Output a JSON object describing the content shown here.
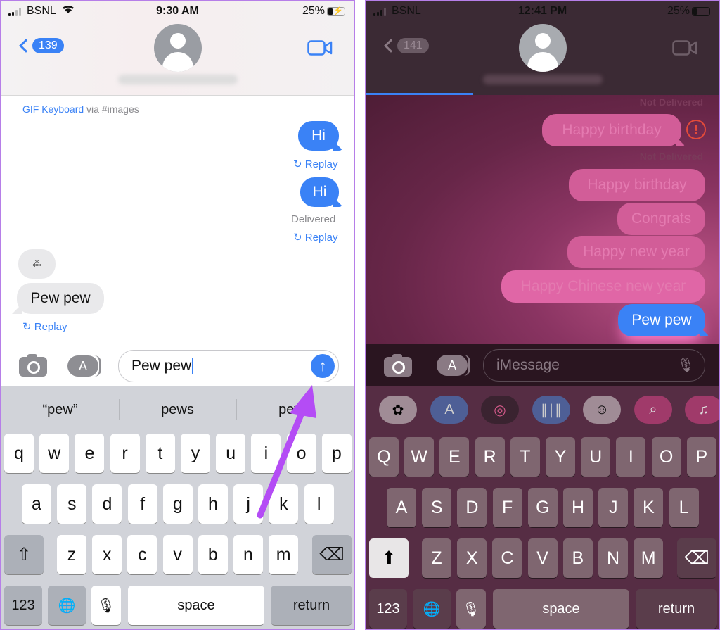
{
  "left": {
    "status": {
      "carrier": "BSNL",
      "time": "9:30 AM",
      "battery": "25%",
      "battery_level": 0.25,
      "charging": true
    },
    "header": {
      "back_count": "139",
      "contact_name": "",
      "video_icon": "video-camera-icon"
    },
    "gif_source": {
      "link": "GIF Keyboard",
      "suffix": " via #images"
    },
    "messages": [
      {
        "side": "sent",
        "text": "Hi"
      },
      {
        "side": "sent",
        "text": "Hi",
        "status": "Delivered"
      },
      {
        "side": "received",
        "text": "Pew pew",
        "sticker": true
      }
    ],
    "replay_label": "Replay",
    "input": {
      "value": "Pew pew",
      "send_icon": "arrow-up-icon"
    },
    "suggestions": [
      "“pew”",
      "pews",
      "pews"
    ],
    "keyboard": {
      "row1": [
        "q",
        "w",
        "e",
        "r",
        "t",
        "y",
        "u",
        "i",
        "o",
        "p"
      ],
      "row2": [
        "a",
        "s",
        "d",
        "f",
        "g",
        "h",
        "j",
        "k",
        "l"
      ],
      "row3": [
        "z",
        "x",
        "c",
        "v",
        "b",
        "n",
        "m"
      ],
      "shift": "⇧",
      "delete": "⌫",
      "numbers": "123",
      "globe": "🌐",
      "mic": "🎙",
      "space": "space",
      "return": "return"
    }
  },
  "right": {
    "status": {
      "carrier": "BSNL",
      "time": "12:41 PM",
      "battery": "25%",
      "battery_level": 0.25
    },
    "header": {
      "back_count": "141",
      "contact_name": "",
      "send_progress": 0.3
    },
    "messages": [
      {
        "text": "Happy birthday",
        "status": "Not Delivered",
        "error": true
      },
      {
        "text": "Happy birthday",
        "status": "Not Delivered"
      },
      {
        "text": "Congrats"
      },
      {
        "text": "Happy new year"
      },
      {
        "text": "Happy Chinese new year"
      },
      {
        "text": "Pew pew",
        "effect": true
      }
    ],
    "error_icon": "!",
    "input": {
      "placeholder": "iMessage"
    },
    "apps": [
      "photos",
      "app-store",
      "fitness",
      "audio",
      "memoji",
      "images-search",
      "music"
    ],
    "keyboard": {
      "row1": [
        "Q",
        "W",
        "E",
        "R",
        "T",
        "Y",
        "U",
        "I",
        "O",
        "P"
      ],
      "row2": [
        "A",
        "S",
        "D",
        "F",
        "G",
        "H",
        "J",
        "K",
        "L"
      ],
      "row3": [
        "Z",
        "X",
        "C",
        "V",
        "B",
        "N",
        "M"
      ],
      "shift": "⬆",
      "delete": "⌫",
      "numbers": "123",
      "globe": "🌐",
      "mic": "🎙",
      "space": "space",
      "return": "return"
    }
  },
  "colors": {
    "imessage_blue": "#3a82f6",
    "annotation_arrow": "#b44cf5",
    "error_red": "#e34a3a"
  }
}
